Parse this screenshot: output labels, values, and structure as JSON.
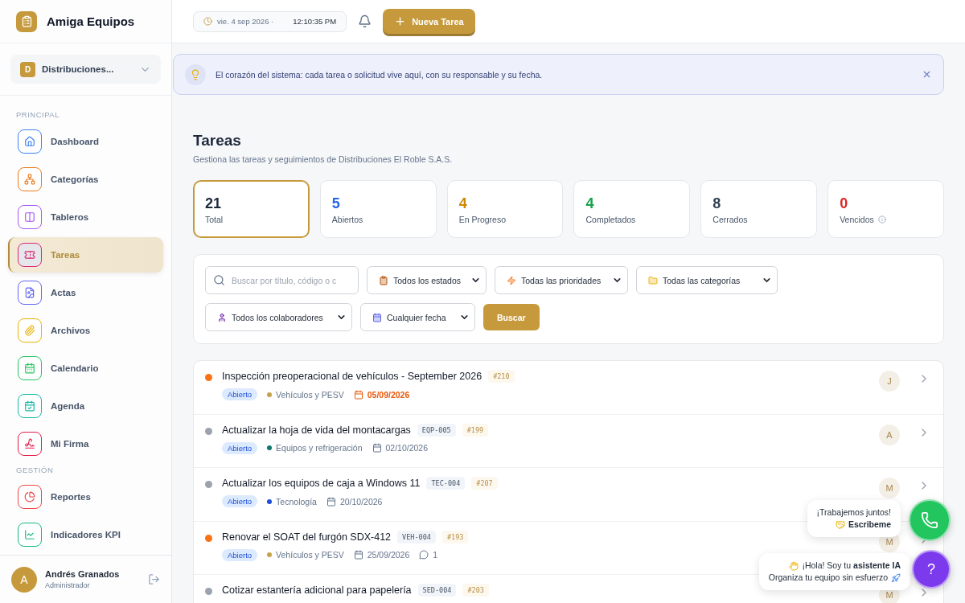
{
  "brand": {
    "name": "Amiga Equipos"
  },
  "org_selector": {
    "initial": "D",
    "name": "Distribuciones..."
  },
  "nav_sections": [
    {
      "title": "PRINCIPAL",
      "items": [
        {
          "label": "Dashboard",
          "color": "#3b82f6",
          "selected": false
        },
        {
          "label": "Categorías",
          "color": "#ea7a1a",
          "selected": false
        },
        {
          "label": "Tableros",
          "color": "#a855f7",
          "selected": false
        },
        {
          "label": "Tareas",
          "color": "#db2777",
          "selected": true
        },
        {
          "label": "Actas",
          "color": "#6366f1",
          "selected": false
        },
        {
          "label": "Archivos",
          "color": "#eab308",
          "selected": false
        },
        {
          "label": "Calendario",
          "color": "#22c55e",
          "selected": false
        },
        {
          "label": "Agenda",
          "color": "#14b8a6",
          "selected": false
        },
        {
          "label": "Mi Firma",
          "color": "#e11d48",
          "selected": false
        }
      ]
    },
    {
      "title": "GESTIÓN",
      "items": [
        {
          "label": "Reportes",
          "color": "#ef4444",
          "selected": false
        },
        {
          "label": "Indicadores KPI",
          "color": "#10b981",
          "selected": false
        }
      ]
    }
  ],
  "user": {
    "initial": "A",
    "name": "Andrés Granados",
    "role": "Administrador"
  },
  "header": {
    "date": "vie. 4 sep 2026 ·",
    "time": "12:10:35 PM",
    "new_button": "Nueva Tarea"
  },
  "banner": {
    "text": "El corazón del sistema: cada tarea o solicitud vive aquí, con su responsable y su fecha."
  },
  "page": {
    "title": "Tareas",
    "subtitle": "Gestiona las tareas y seguimientos de Distribuciones El Roble S.A.S."
  },
  "stats": [
    {
      "value": "21",
      "label": "Total",
      "color": "#1e293b",
      "selected": true
    },
    {
      "value": "5",
      "label": "Abiertos",
      "color": "#2563eb",
      "selected": false
    },
    {
      "value": "4",
      "label": "En Progreso",
      "color": "#ca8a04",
      "selected": false
    },
    {
      "value": "4",
      "label": "Completados",
      "color": "#16a34a",
      "selected": false
    },
    {
      "value": "8",
      "label": "Cerrados",
      "color": "#334155",
      "selected": false
    },
    {
      "value": "0",
      "label": "Vencidos",
      "color": "#dc2626",
      "selected": false
    }
  ],
  "filters": {
    "search_placeholder": "Buscar por título, código o c",
    "selects": [
      "Todos los estados",
      "Todas las prioridades",
      "Todas las categorías",
      "Todos los colaboradores",
      "Cualquier fecha"
    ],
    "button": "Buscar"
  },
  "tasks": [
    {
      "title": "Inspección preoperacional de vehículos - September 2026",
      "number": "#210",
      "status": "Abierto",
      "category": {
        "label": "Vehículos y PESV",
        "color": "#c9a14a"
      },
      "date": "05/09/2026",
      "due_soon": true,
      "color": "#f97316",
      "assignee": "J"
    },
    {
      "title": "Actualizar la hoja de vida del montacargas",
      "code": "EQP-005",
      "number": "#199",
      "status": "Abierto",
      "category": {
        "label": "Equipos y refrigeración",
        "color": "#0f766e"
      },
      "date": "02/10/2026",
      "due_soon": false,
      "color": "#9ca3af",
      "assignee": "A"
    },
    {
      "title": "Actualizar los equipos de caja a Windows 11",
      "code": "TEC-004",
      "number": "#207",
      "status": "Abierto",
      "category": {
        "label": "Tecnología",
        "color": "#1d4ed8"
      },
      "date": "20/10/2026",
      "due_soon": false,
      "color": "#9ca3af",
      "assignee": "M"
    },
    {
      "title": "Renovar el SOAT del furgón SDX-412",
      "code": "VEH-004",
      "number": "#193",
      "status": "Abierto",
      "category": {
        "label": "Vehículos y PESV",
        "color": "#c9a14a"
      },
      "date": "25/09/2026",
      "due_soon": false,
      "comments": "1",
      "color": "#f97316",
      "assignee": "M"
    },
    {
      "title": "Cotizar estantería adicional para papelería",
      "code": "SED-004",
      "number": "#203",
      "color": "#9ca3af",
      "assignee": "M"
    }
  ],
  "whatsapp_bubble": {
    "line1": "¡Trabajemos juntos!",
    "line2": "Escribeme"
  },
  "assistant_bubble": {
    "line1": "¡Hola! Soy tu **asistente IA**",
    "line2": "Organiza tu equipo sin esfuerzo"
  },
  "help_button": {
    "label": "?"
  }
}
